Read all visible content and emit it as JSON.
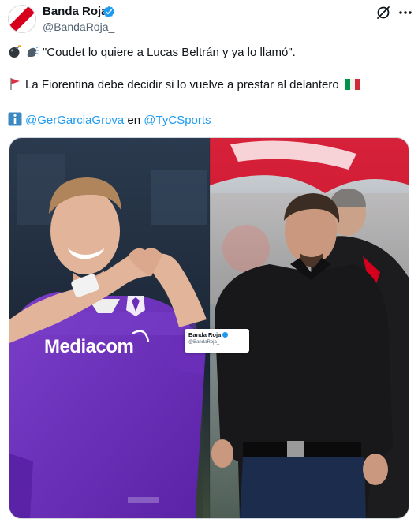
{
  "author": {
    "name": "Banda Roja",
    "handle": "@BandaRoja_"
  },
  "icons": {
    "verified": "verified-badge-icon",
    "grok": "grok-icon",
    "more": "more-options-icon",
    "bomb": "bomb-emoji",
    "speaking": "speaking-head-emoji",
    "flag": "triangular-flag-emoji",
    "italy": "italy-flag-emoji",
    "info": "information-emoji"
  },
  "tweet": {
    "line1": "\"Coudet lo quiere a Lucas Beltrán y ya lo llamó\".",
    "line2": "La Fiorentina debe decidir si lo vuelve a prestar al delantero",
    "line3_mention1": "@GerGarciaGrova",
    "line3_connector": " en ",
    "line3_mention2": "@TyCSports"
  },
  "media": {
    "overlay_name": "Banda Roja",
    "overlay_handle": "@BandaRoja_",
    "jersey_sponsor": "Mediacom"
  },
  "colors": {
    "accent": "#1d9bf0",
    "text": "#0f1419",
    "secondary": "#536471",
    "fiorentina_purple": "#6a2cb8",
    "river_red": "#d6001c"
  }
}
